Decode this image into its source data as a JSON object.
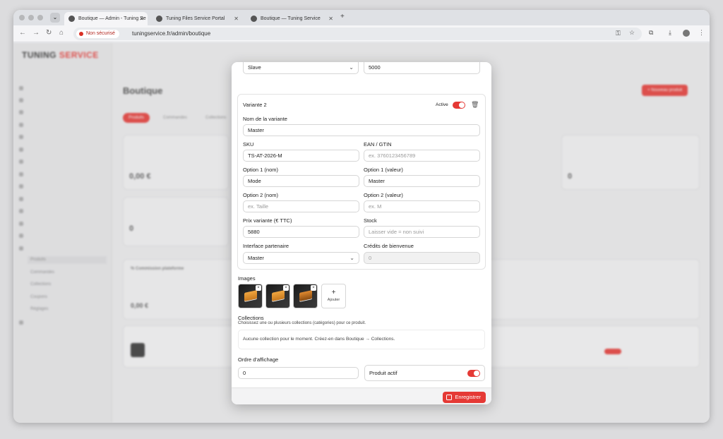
{
  "browser": {
    "tabs": [
      {
        "label": "Boutique — Admin - Tuning Se",
        "active": true
      },
      {
        "label": "Tuning Files Service Portal",
        "active": false
      },
      {
        "label": "Boutique — Tuning Service",
        "active": false
      }
    ],
    "security_label": "Non sécurisé",
    "url": "tuningservice.fr/admin/boutique"
  },
  "background": {
    "brand": {
      "part1": "TUNING",
      "part2": "SERVICE"
    },
    "page_title": "Boutique",
    "primary_action": "+ Nouveau produit",
    "tabs": [
      "Produits",
      "Commandes",
      "Collections"
    ],
    "commission_title": "% Commission plateforme",
    "stat_value": "0,00 €",
    "stat_zero": "0",
    "sidebar_subitems": [
      "Produits",
      "Commandes",
      "Collections",
      "Coupons",
      "Réglages"
    ]
  },
  "modal": {
    "top_row": {
      "select_value": "Slave",
      "input_value": "5000"
    },
    "variant": {
      "title": "Variante 2",
      "active_label": "Active",
      "active": true,
      "name_label": "Nom de la variante",
      "name_value": "Master",
      "sku_label": "SKU",
      "sku_value": "TS-AT-2026-M",
      "ean_label": "EAN / GTIN",
      "ean_placeholder": "ex. 3760123456789",
      "opt1_name_label": "Option 1 (nom)",
      "opt1_name_value": "Mode",
      "opt1_value_label": "Option 1 (valeur)",
      "opt1_value_value": "Master",
      "opt2_name_label": "Option 2 (nom)",
      "opt2_name_placeholder": "ex. Taille",
      "opt2_value_label": "Option 2 (valeur)",
      "opt2_value_placeholder": "ex. M",
      "price_label": "Prix variante (€ TTC)",
      "price_value": "5880",
      "stock_label": "Stock",
      "stock_placeholder": "Laisser vide = non suivi",
      "partner_label": "Interface partenaire",
      "partner_value": "Master",
      "credits_label": "Crédits de bienvenue",
      "credits_value": "0"
    },
    "images_label": "Images",
    "add_image_label": "Ajouter",
    "add_image_plus": "+",
    "collections_label": "Collections",
    "collections_help": "Choisissez une ou plusieurs collections (catégories) pour ce produit.",
    "collections_empty": "Aucune collection pour le moment. Créez-en dans Boutique → Collections.",
    "display_order_label": "Ordre d'affichage",
    "display_order_value": "0",
    "product_active_label": "Produit actif",
    "product_active": true,
    "save_label": "Enregistrer"
  },
  "colors": {
    "accent": "#e53935"
  },
  "icons": {
    "trash": "trash-icon",
    "save": "floppy-disk-icon",
    "chevron": "chevron-down-icon"
  }
}
